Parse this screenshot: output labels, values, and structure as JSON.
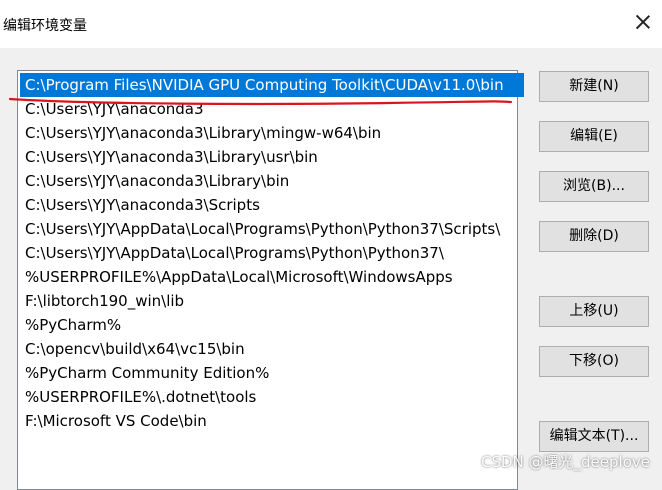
{
  "window": {
    "title": "编辑环境变量",
    "close_icon": "close-icon"
  },
  "list": {
    "items": [
      "C:\\Program Files\\NVIDIA GPU Computing Toolkit\\CUDA\\v11.0\\bin",
      "C:\\Users\\YJY\\anaconda3",
      "C:\\Users\\YJY\\anaconda3\\Library\\mingw-w64\\bin",
      "C:\\Users\\YJY\\anaconda3\\Library\\usr\\bin",
      "C:\\Users\\YJY\\anaconda3\\Library\\bin",
      "C:\\Users\\YJY\\anaconda3\\Scripts",
      "C:\\Users\\YJY\\AppData\\Local\\Programs\\Python\\Python37\\Scripts\\",
      "C:\\Users\\YJY\\AppData\\Local\\Programs\\Python\\Python37\\",
      "%USERPROFILE%\\AppData\\Local\\Microsoft\\WindowsApps",
      "F:\\libtorch190_win\\lib",
      "%PyCharm%",
      "C:\\opencv\\build\\x64\\vc15\\bin",
      "%PyCharm Community Edition%",
      "%USERPROFILE%\\.dotnet\\tools",
      "F:\\Microsoft VS Code\\bin"
    ],
    "selected_index": 0
  },
  "buttons": {
    "new": "新建(N)",
    "edit": "编辑(E)",
    "browse": "浏览(B)...",
    "delete": "删除(D)",
    "move_up": "上移(U)",
    "move_down": "下移(O)",
    "edit_text": "编辑文本(T)..."
  },
  "watermark": "CSDN @曙光_deeplove",
  "colors": {
    "selection": "#0078d7",
    "annotation_stroke": "#d9151d"
  }
}
